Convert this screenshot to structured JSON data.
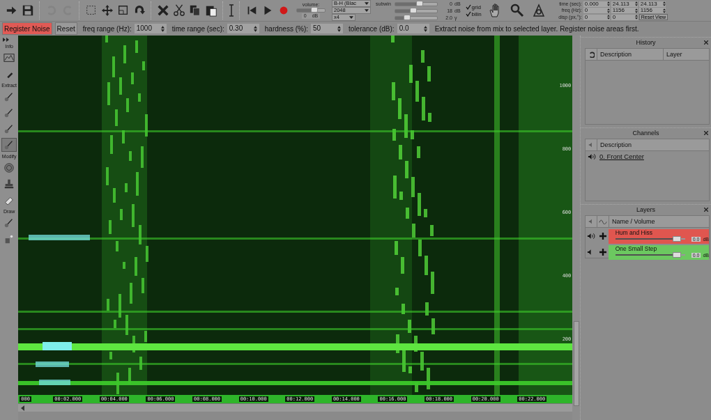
{
  "toolbar": {
    "buttons": [
      {
        "kind": "import",
        "disabled": false
      },
      {
        "kind": "save",
        "disabled": false
      },
      {
        "kind": "undo",
        "disabled": true
      },
      {
        "kind": "redo",
        "disabled": true
      },
      {
        "kind": "select",
        "disabled": false
      },
      {
        "kind": "move",
        "disabled": false
      },
      {
        "kind": "crop",
        "disabled": false
      },
      {
        "kind": "rotate",
        "disabled": false
      },
      {
        "kind": "delete",
        "disabled": false
      },
      {
        "kind": "cut",
        "disabled": false
      },
      {
        "kind": "copy",
        "disabled": false
      },
      {
        "kind": "paste",
        "disabled": false
      },
      {
        "kind": "cursor",
        "disabled": false
      },
      {
        "kind": "skip_start",
        "disabled": false
      },
      {
        "kind": "play",
        "disabled": false
      },
      {
        "kind": "record",
        "disabled": false
      }
    ],
    "volume": {
      "label": "volume:",
      "level": 0.5,
      "reading": "0",
      "unit": "dB"
    },
    "dropdowns": [
      "B-H (Blac",
      "2048",
      "x4"
    ],
    "subwin": {
      "label": "subwin",
      "sliders": [
        {
          "level": 0.5,
          "reading": "0",
          "unit": "dB"
        },
        {
          "level": 0.35,
          "reading": "18",
          "unit": "dB"
        },
        {
          "level": 0.2,
          "reading": "2.0",
          "unit": "γ"
        }
      ]
    },
    "checkboxes": [
      {
        "label": "grid",
        "checked": true
      },
      {
        "label": "bilin",
        "checked": true
      }
    ],
    "view_tools": [
      {
        "kind": "hand"
      },
      {
        "kind": "zoom"
      },
      {
        "kind": "compass"
      }
    ],
    "view_fields": [
      {
        "label": "time (sec):",
        "values": [
          "0.000",
          "24.113",
          "24.113"
        ]
      },
      {
        "label": "freq (Hz):",
        "values": [
          "0",
          "1156",
          "1156"
        ]
      },
      {
        "label": "disp (px,°):",
        "values": [
          "0",
          "0"
        ]
      }
    ],
    "reset_view": "Reset View"
  },
  "noise_bar": {
    "buttons": [
      {
        "label": "Register Noise",
        "selected": true
      },
      {
        "label": "Reset",
        "selected": false
      }
    ],
    "params": [
      {
        "label": "freq range (Hz):",
        "value": "1000"
      },
      {
        "label": "time range (sec):",
        "value": "0.30"
      },
      {
        "label": "hardness (%):",
        "value": "50"
      },
      {
        "label": "tolerance (dB):",
        "value": "0.0"
      }
    ],
    "message": "Extract noise from mix to selected layer. Register noise areas first."
  },
  "palette": {
    "sections": [
      {
        "label": "Info",
        "tools": [
          {
            "kind": "graph",
            "selected": false
          },
          {
            "kind": "pipette",
            "selected": false
          }
        ]
      },
      {
        "label": "Extract",
        "tools": [
          {
            "kind": "brush",
            "selected": false
          },
          {
            "kind": "brush",
            "selected": false
          },
          {
            "kind": "brush",
            "selected": false
          },
          {
            "kind": "brush",
            "selected": true
          }
        ]
      },
      {
        "label": "Modify",
        "tools": [
          {
            "kind": "circle",
            "selected": false
          },
          {
            "kind": "stamp",
            "selected": false
          },
          {
            "kind": "eraser",
            "selected": false
          }
        ]
      },
      {
        "label": "Draw",
        "tools": [
          {
            "kind": "brush",
            "selected": false
          },
          {
            "kind": "spray",
            "selected": false
          }
        ]
      }
    ]
  },
  "spectrogram": {
    "freq_labels": [
      "1000",
      "800",
      "600",
      "400",
      "200"
    ],
    "time_labels": [
      "000",
      "00:02.000",
      "00:04.000",
      "00:06.000",
      "00:08.000",
      "00:10.000",
      "00:12.000",
      "00:14.000",
      "00:16.000",
      "00:18.000",
      "00:20.000",
      "00:22.000"
    ]
  },
  "history": {
    "title": "History",
    "columns": [
      "Description",
      "Layer"
    ]
  },
  "channels": {
    "title": "Channels",
    "column": "Description",
    "rows": [
      {
        "name": "0. Front Center",
        "sound_on": true
      }
    ]
  },
  "layers": {
    "title": "Layers",
    "column": "Name / Volume",
    "rows": [
      {
        "name": "Hum and Hiss",
        "color": "#e0564f",
        "sound_on": true,
        "level": 0.82,
        "reading": "0.0",
        "unit": "dB"
      },
      {
        "name": "One Small Step",
        "color": "#6cc860",
        "sound_on": false,
        "level": 0.82,
        "reading": "0.0",
        "unit": "dB"
      }
    ]
  }
}
